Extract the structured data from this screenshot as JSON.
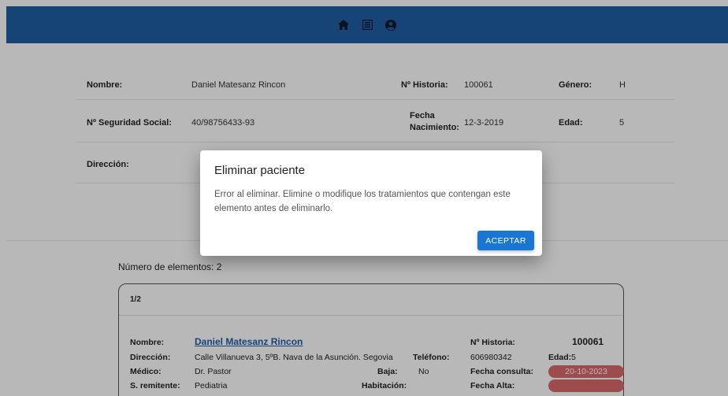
{
  "header": {
    "icons": [
      "home-icon",
      "list-icon",
      "account-icon"
    ]
  },
  "patient": {
    "nombre_label": "Nombre:",
    "nombre": "Daniel Matesanz Rincon",
    "historia_label": "Nº Historia:",
    "historia": "100061",
    "genero_label": "Género:",
    "genero": "H",
    "nss_label": "Nº Seguridad Social:",
    "nss": "40/98756433-93",
    "fecha_nac_label_1": "Fecha",
    "fecha_nac_label_2": "Nacimiento:",
    "fecha_nac": "12-3-2019",
    "edad_label": "Edad:",
    "edad": "5",
    "direccion_label": "Dirección:"
  },
  "list": {
    "count_text": "Número de elementos: 2",
    "card": {
      "index": "1/2",
      "nombre_label": "Nombre:",
      "nombre": "Daniel Matesanz Rincon",
      "historia_label": "Nº Historia:",
      "historia": "100061",
      "direccion_label": "Dirección:",
      "direccion": "Calle Villanueva 3, 5ºB. Nava de la Asunción. Segovia",
      "telefono_label": "Teléfono:",
      "telefono": "606980342",
      "edad_label": "Edad:",
      "edad": "5",
      "medico_label": "Médico:",
      "medico": "Dr. Pastor",
      "baja_label": "Baja:",
      "baja": "No",
      "fecha_consulta_label": "Fecha consulta:",
      "fecha_consulta": "20-10-2023",
      "remitente_label": "S. remitente:",
      "remitente": "Pediatria",
      "habitacion_label": "Habitación:",
      "fecha_alta_label": "Fecha Alta:"
    }
  },
  "dialog": {
    "title": "Eliminar paciente",
    "message": "Error al eliminar. Elimine o modifique los tratamientos que contengan este elemento antes de eliminarlo.",
    "accept_label": "ACEPTAR"
  },
  "colors": {
    "header": "#1f5fa5",
    "accent": "#1976d2",
    "pill": "#d96a6a"
  }
}
